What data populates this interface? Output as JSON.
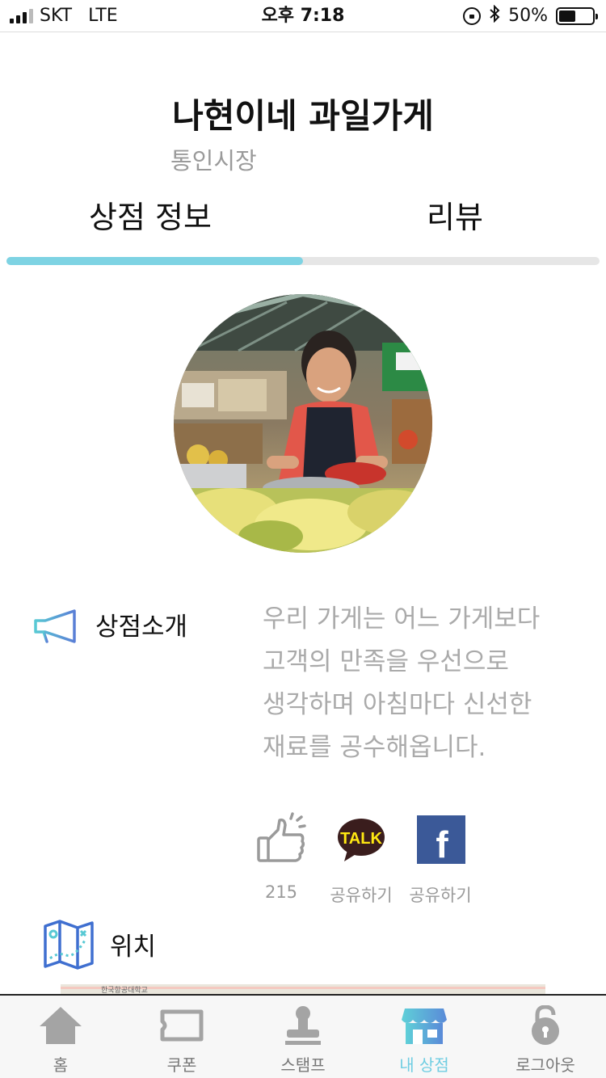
{
  "status_bar": {
    "carrier": "SKT",
    "network": "LTE",
    "time": "오후 7:18",
    "battery_percent": "50%",
    "battery_level": 0.5,
    "signal_bars_active": 3,
    "signal_bars_total": 4
  },
  "header": {
    "title": "나현이네 과일가게",
    "market": "통인시장"
  },
  "tabs": [
    {
      "label": "상점 정보",
      "active": true
    },
    {
      "label": "리뷰",
      "active": false
    }
  ],
  "tab_indicator": {
    "fraction": 0.5,
    "color": "#7ed3e3"
  },
  "intro": {
    "label": "상점소개",
    "lines": [
      "우리 가게는 어느 가게보다",
      "고객의 만족을 우선으로",
      "생각하며 아침마다 신선한",
      "재료를 공수해옵니다."
    ]
  },
  "share": {
    "like_count": "215",
    "kakao_label": "공유하기",
    "kakao_icon_text": "TALK",
    "facebook_label": "공유하기",
    "facebook_icon_text": "f"
  },
  "location": {
    "label": "위치",
    "map_text": "한국항공대학교"
  },
  "bottom_tabs": [
    {
      "label": "홈",
      "icon": "home-icon",
      "active": false
    },
    {
      "label": "쿠폰",
      "icon": "coupon-icon",
      "active": false
    },
    {
      "label": "스탬프",
      "icon": "stamp-icon",
      "active": false
    },
    {
      "label": "내 상점",
      "icon": "store-icon",
      "active": true
    },
    {
      "label": "로그아웃",
      "icon": "lock-icon",
      "active": false
    }
  ],
  "colors": {
    "accent": "#6fcde2",
    "muted_text": "#9a9a9a",
    "facebook": "#3b5998",
    "kakao": "#3a1d1d",
    "kakao_yellow": "#ffe812"
  }
}
